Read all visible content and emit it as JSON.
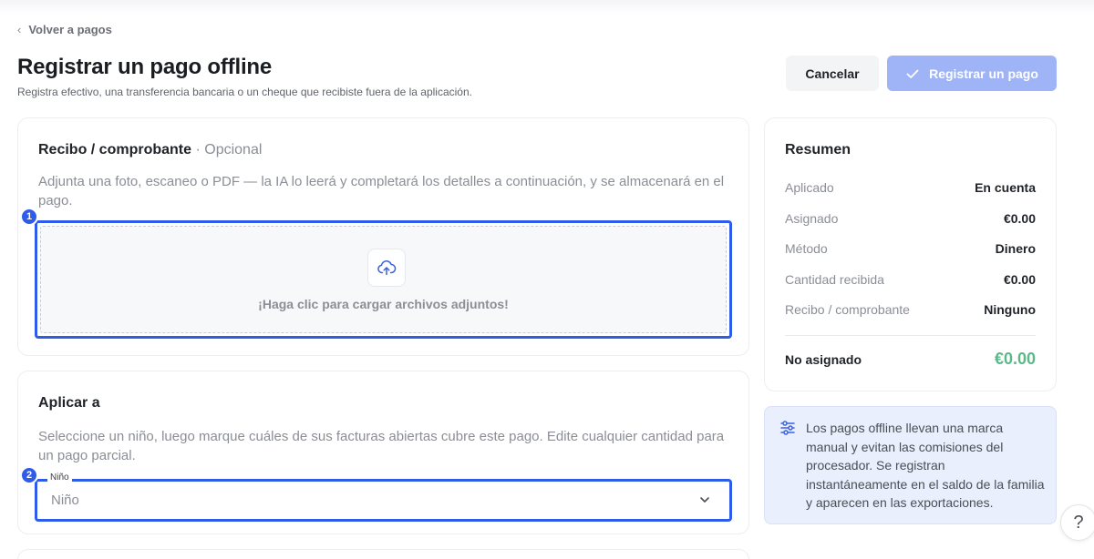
{
  "nav": {
    "back_label": "Volver a pagos"
  },
  "header": {
    "title": "Registrar un pago offline",
    "subtitle": "Registra efectivo, una transferencia bancaria o un cheque que recibiste fuera de la aplicación.",
    "cancel_label": "Cancelar",
    "submit_label": "Registrar un pago"
  },
  "receipt": {
    "title": "Recibo / comprobante",
    "optional": "· Opcional",
    "description": "Adjunta una foto, escaneo o PDF — la IA lo leerá y completará los detalles a continuación, y se almacenará en el pago.",
    "step": "1",
    "upload_text": "¡Haga clic para cargar archivos adjuntos!"
  },
  "apply": {
    "title": "Aplicar a",
    "description": "Seleccione un niño, luego marque cuáles de sus facturas abiertas cubre este pago. Edite cualquier cantidad para un pago parcial.",
    "step": "2",
    "child_label": "Niño",
    "child_placeholder": "Niño"
  },
  "summary": {
    "title": "Resumen",
    "rows": [
      {
        "label": "Aplicado",
        "value": "En cuenta"
      },
      {
        "label": "Asignado",
        "value": "€0.00"
      },
      {
        "label": "Método",
        "value": "Dinero"
      },
      {
        "label": "Cantidad recibida",
        "value": "€0.00"
      },
      {
        "label": "Recibo / comprobante",
        "value": "Ninguno"
      }
    ],
    "total_label": "No asignado",
    "total_value": "€0.00"
  },
  "info": {
    "text": "Los pagos offline llevan una marca manual y evitan las comisiones del procesador. Se registran instantáneamente en el saldo de la familia y aparecen en las exportaciones."
  },
  "help": {
    "label": "?"
  },
  "colors": {
    "accent": "#2f5bea",
    "submit_disabled": "#9fb4f6",
    "total_positive": "#5cb88a",
    "info_bg": "#e9effd"
  },
  "icons": [
    "chevron-left-icon",
    "check-icon",
    "upload-cloud-icon",
    "chevron-down-icon",
    "sliders-icon",
    "help-icon"
  ]
}
